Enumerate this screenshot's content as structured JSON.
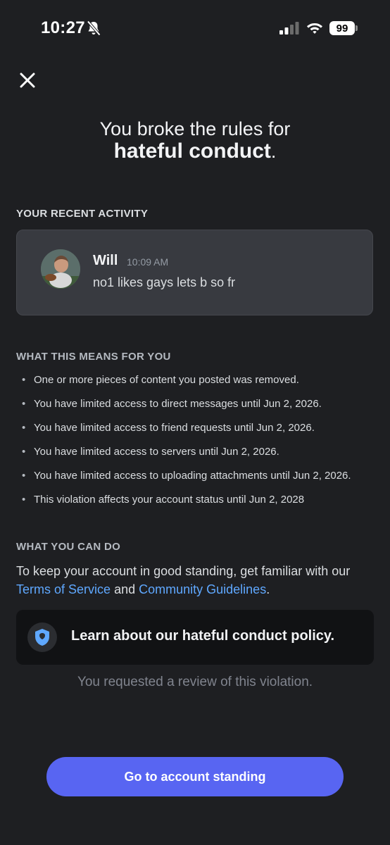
{
  "status_bar": {
    "time": "10:27",
    "battery": "99"
  },
  "header": {
    "title_line1": "You broke the rules for",
    "title_strong": "hateful conduct",
    "title_suffix": "."
  },
  "activity": {
    "label": "YOUR RECENT ACTIVITY",
    "author": "Will",
    "timestamp": "10:09 AM",
    "message": "no1 likes gays lets b so fr"
  },
  "means": {
    "label": "WHAT THIS MEANS FOR YOU",
    "items": [
      "One or more pieces of content you posted was removed.",
      "You have limited access to direct messages until Jun 2, 2026.",
      "You have limited access to friend requests until Jun 2, 2026.",
      "You have limited access to servers until Jun 2, 2026.",
      "You have limited access to uploading attachments until Jun 2, 2026.",
      "This violation affects your account status until Jun 2, 2028"
    ]
  },
  "can_do": {
    "label": "WHAT YOU CAN DO",
    "text_before": "To keep your account in good standing, get familiar with our",
    "tos_link": "Terms of Service",
    "and": "and",
    "guidelines_link": "Community Guidelines",
    "end": "."
  },
  "policy_card": {
    "label": "Learn about our hateful conduct policy."
  },
  "review_note": "You requested a review of this violation.",
  "cta": {
    "label": "Go to account standing"
  },
  "colors": {
    "accent": "#5865f2",
    "link": "#5fa8ff",
    "background": "#1e1f22"
  }
}
